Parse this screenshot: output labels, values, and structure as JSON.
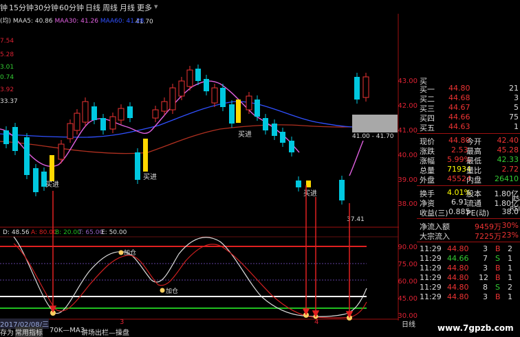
{
  "toolbar": {
    "prefix": "钟",
    "items": [
      "15分钟",
      "30分钟",
      "60分钟",
      "日线",
      "周线",
      "月线",
      "更多"
    ]
  },
  "ma_legend": {
    "prefix": "(均)",
    "ma5": "MAA5: 40.86",
    "ma30": "MAA30: 41.26",
    "ma60": "MAA60: 41.28",
    "peak": "41.70"
  },
  "left_prices": [
    "7.54",
    "5.28",
    "3.01",
    "0.74",
    "3.92",
    "33.37"
  ],
  "right_axis": [
    "43.00",
    "42.00",
    "41.00",
    "40.00",
    "39.00",
    "38.00"
  ],
  "indicator_axis": [
    "90.00",
    "75.00",
    "60.00",
    "45.00",
    "30.00"
  ],
  "indicator_legend": {
    "d": "D: 48.56",
    "a": "A: 80.00",
    "b": "B: 20.00",
    "t": "T: 65.00",
    "e": "E: 50.00"
  },
  "signals": {
    "buy": "买进",
    "add": "加仓"
  },
  "range_label": "41.00 - 41.70",
  "low_label": "37.41",
  "period_markers": [
    "3",
    "4"
  ],
  "date_label": "2017/02/08/三",
  "bottom_tabs": [
    "存为",
    "常用指标",
    "70K—MA3",
    "讲场出栏—操盘"
  ],
  "bottom_right": "日线",
  "quote": {
    "bids": [
      {
        "label": "买一",
        "price": "44.80",
        "vol": "21"
      },
      {
        "label": "买二",
        "price": "44.68",
        "vol": "3"
      },
      {
        "label": "买三",
        "price": "44.67",
        "vol": "5"
      },
      {
        "label": "买四",
        "price": "44.66",
        "vol": "75"
      },
      {
        "label": "买五",
        "price": "44.63",
        "vol": "1"
      }
    ],
    "top_partial": "买",
    "stats": [
      {
        "l1": "现价",
        "v1": "44.80",
        "l2": "今开",
        "v2": "42.40"
      },
      {
        "l1": "涨跌",
        "v1": "2.53",
        "l2": "最高",
        "v2": "45.28"
      },
      {
        "l1": "涨幅",
        "v1": "5.99%",
        "l2": "最低",
        "v2": "42.33"
      },
      {
        "l1": "总量",
        "v1": "71934",
        "l2": "量比",
        "v2": "2.72"
      },
      {
        "l1": "外盘",
        "v1": "45524",
        "l2": "内盘",
        "v2": "26410"
      },
      {
        "l1": "换手",
        "v1": "4.01%",
        "l2": "股本",
        "v2": "1.80亿"
      },
      {
        "l1": "净资",
        "v1": "6.91",
        "l2": "流通",
        "v2": "1.80亿"
      },
      {
        "l1": "收益(三)",
        "v1": "0.885",
        "l2": "PE(动)",
        "v2": "38.0"
      }
    ],
    "flows": [
      {
        "label": "净流入额",
        "val": "9459万",
        "pct": "30%"
      },
      {
        "label": "大宗流入",
        "val": "7225万",
        "pct": "23%"
      }
    ],
    "ticks": [
      {
        "time": "11:29",
        "price": "44.80",
        "vol": "3",
        "side": "B",
        "n": "2"
      },
      {
        "time": "11:29",
        "price": "44.66",
        "vol": "7",
        "side": "S",
        "n": "1"
      },
      {
        "time": "11:29",
        "price": "44.80",
        "vol": "3",
        "side": "B",
        "n": "1"
      },
      {
        "time": "11:29",
        "price": "44.80",
        "vol": "12",
        "side": "B",
        "n": "1"
      },
      {
        "time": "11:29",
        "price": "44.80",
        "vol": "8",
        "side": "S",
        "n": "2"
      },
      {
        "time": "11:29",
        "price": "44.80",
        "vol": "3",
        "side": "B",
        "n": "1"
      }
    ],
    "side_labels": [
      "RS",
      "RSI",
      "S"
    ]
  },
  "watermark": "www.7gpzb.com",
  "colors": {
    "up": "#e33",
    "down": "#00c8e0",
    "ma5": "#e060e0",
    "ma30": "#3050ff",
    "ma60": "#b03020",
    "signal": "#ffd800",
    "kd_red": "#d02020",
    "kd_white": "#dddddd",
    "line_b": "#20c020",
    "line_a": "#e02020",
    "line_t": "#ffffff"
  }
}
